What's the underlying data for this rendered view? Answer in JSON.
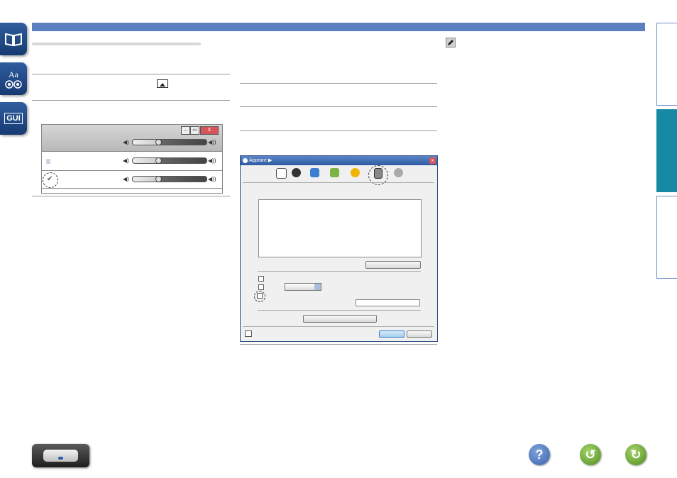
{
  "side_tabs": {
    "tab1_icon": "book-icon",
    "tab2_text": "Aa",
    "tab2_icon": "speaker-icon",
    "tab3_text": "GUI"
  },
  "speaker_window": {
    "close_label": "X"
  },
  "prefs_window": {
    "title": "Apprare",
    "toolbar_icons": [
      "general-icon",
      "playback-icon",
      "sharing-icon",
      "store-icon",
      "parental-icon",
      "devices-icon",
      "advanced-icon"
    ],
    "close_label": "x"
  },
  "footer": {
    "help_icon": "question-icon",
    "back_icon": "back-arrow-icon",
    "forward_icon": "forward-arrow-icon"
  },
  "colors": {
    "topbar": "#5b7fc1",
    "right_tab_active": "#168aa5",
    "help_button": "#4d78b8",
    "nav_button": "#6aa632"
  }
}
